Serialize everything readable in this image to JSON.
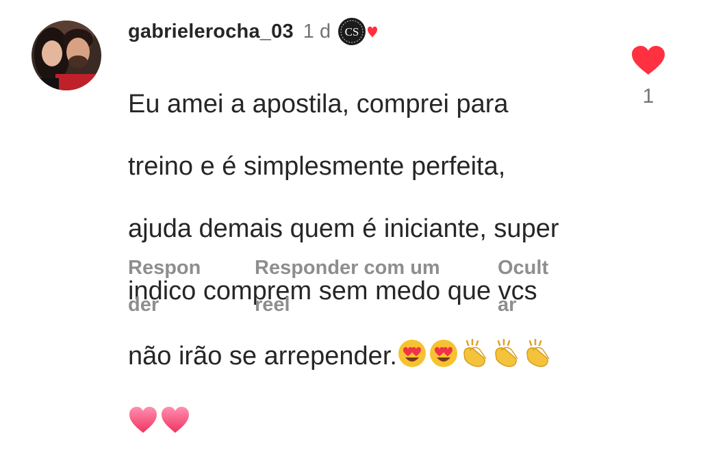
{
  "comment": {
    "username": "gabrielerocha_03",
    "time": "1 d",
    "text_lines": [
      "Eu amei a apostila, comprei para",
      "treino e é simplesmente perfeita,",
      "ajuda demais quem é iniciante, super",
      "indico comprem sem medo que vcs",
      "não irão se arrepender."
    ],
    "emojis": [
      "heart-eyes-emoji",
      "heart-eyes-emoji",
      "clapping-hands-emoji",
      "clapping-hands-emoji",
      "clapping-hands-emoji",
      "pink-heart-emoji",
      "pink-heart-emoji"
    ],
    "badge_icon": "cs-badge-with-heart",
    "avatar_icon": "profile-photo"
  },
  "likes": {
    "icon": "heart-icon",
    "count": "1",
    "color": "#ff3040"
  },
  "actions": {
    "reply_label": "Respon\nder",
    "reply_reel_label": "Responder com um\nreel",
    "hide_label": "Ocult\nar"
  },
  "colors": {
    "text": "#262626",
    "secondary": "#737373",
    "action": "#8e8e8e",
    "background": "#ffffff"
  }
}
